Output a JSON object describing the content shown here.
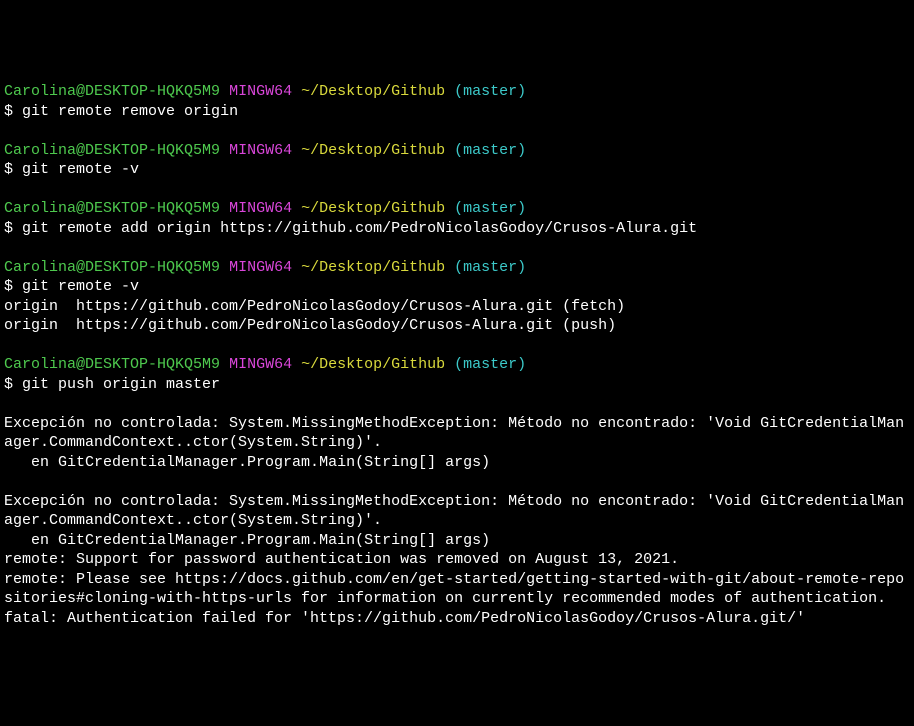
{
  "prompt": {
    "user": "Carolina@DESKTOP-HQKQ5M9",
    "host": "MINGW64",
    "path": "~/Desktop/Github",
    "branch": "(master)",
    "dollar": "$"
  },
  "lines": {
    "cmd1": "git remote remove origin",
    "cmd2": "git remote -v",
    "cmd3": "git remote add origin https://github.com/PedroNicolasGodoy/Crusos-Alura.git",
    "cmd4": "git remote -v",
    "out4a": "origin  https://github.com/PedroNicolasGodoy/Crusos-Alura.git (fetch)",
    "out4b": "origin  https://github.com/PedroNicolasGodoy/Crusos-Alura.git (push)",
    "cmd5": "git push origin master",
    "err1": "Excepción no controlada: System.MissingMethodException: Método no encontrado: 'Void GitCredentialManager.CommandContext..ctor(System.String)'.",
    "err2": "   en GitCredentialManager.Program.Main(String[] args)",
    "err3": "Excepción no controlada: System.MissingMethodException: Método no encontrado: 'Void GitCredentialManager.CommandContext..ctor(System.String)'.",
    "err4": "   en GitCredentialManager.Program.Main(String[] args)",
    "err5": "remote: Support for password authentication was removed on August 13, 2021.",
    "err6": "remote: Please see https://docs.github.com/en/get-started/getting-started-with-git/about-remote-repositories#cloning-with-https-urls for information on currently recommended modes of authentication.",
    "err7": "fatal: Authentication failed for 'https://github.com/PedroNicolasGodoy/Crusos-Alura.git/'"
  }
}
